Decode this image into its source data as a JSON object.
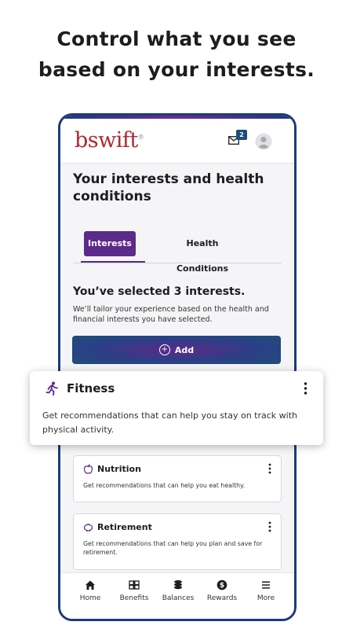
{
  "headline": {
    "line1": "Control what you see",
    "line2": "based on your interests."
  },
  "app": {
    "logo": "bswift",
    "logo_mark": "®",
    "message_count": "2"
  },
  "page": {
    "title": "Your interests and health conditions",
    "tabs": [
      {
        "label": "Interests",
        "active": true
      },
      {
        "label": "Health Conditions",
        "active": false
      }
    ],
    "selected_heading": "You’ve selected 3 interests.",
    "selected_description": "We’ll tailor your experience based on the health and financial interests you have selected.",
    "add_label": "Add"
  },
  "interests": [
    {
      "title": "Fitness",
      "icon": "running-icon",
      "description": "Get recommendations that can help you stay on track with physical activity."
    },
    {
      "title": "Nutrition",
      "icon": "apple-icon",
      "description": "Get recommendations that can help you eat healthy."
    },
    {
      "title": "Retirement",
      "icon": "piggy-bank-icon",
      "description": "Get recommendations that can help you plan and save for retirement."
    }
  ],
  "bottom_nav": [
    {
      "label": "Home",
      "icon": "home-icon"
    },
    {
      "label": "Benefits",
      "icon": "benefits-icon"
    },
    {
      "label": "Balances",
      "icon": "coins-icon"
    },
    {
      "label": "Rewards",
      "icon": "dollar-icon"
    },
    {
      "label": "More",
      "icon": "menu-icon"
    }
  ],
  "colors": {
    "brand_red": "#b0282e",
    "accent_purple": "#5b2a8a",
    "navy": "#1f4e79"
  }
}
